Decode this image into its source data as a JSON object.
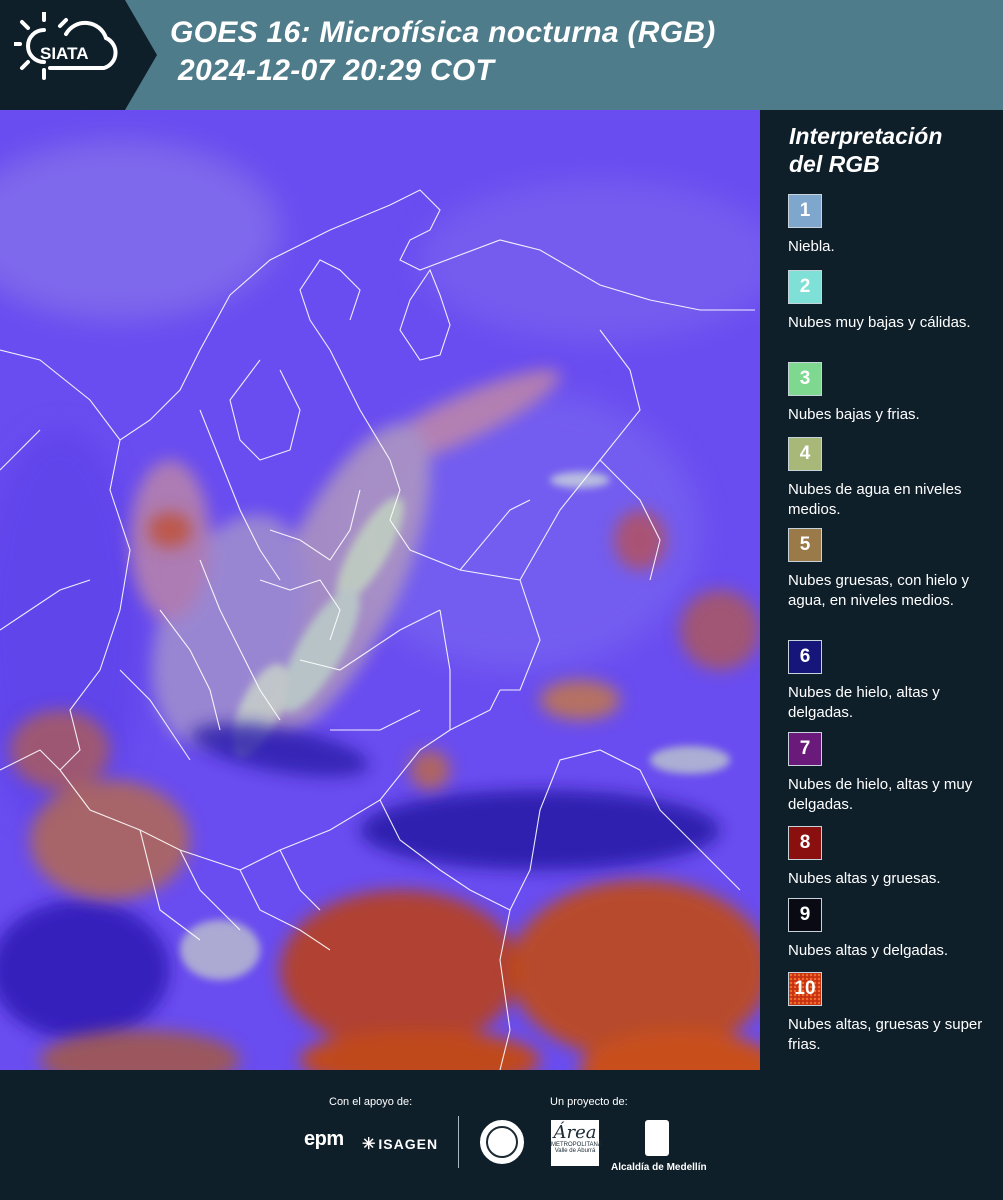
{
  "header": {
    "logo_text": "SIATA",
    "title_line1": "GOES 16: Microfísica nocturna (RGB)",
    "title_line2": "2024-12-07 20:29 COT",
    "bg_color": "#4e7c8a"
  },
  "legend": {
    "title_line1": "Interpretación",
    "title_line2": "del RGB",
    "items": [
      {
        "number": "1",
        "label": "Niebla.",
        "color": "#7fa6cc"
      },
      {
        "number": "2",
        "label": "Nubes muy bajas y cálidas.",
        "color": "#7ee0d6"
      },
      {
        "number": "3",
        "label": "Nubes bajas y frias.",
        "color": "#7fd890"
      },
      {
        "number": "4",
        "label": "Nubes de agua en niveles medios.",
        "color": "#a8b878"
      },
      {
        "number": "5",
        "label": "Nubes gruesas, con hielo y agua, en niveles medios.",
        "color": "#9a7a48"
      },
      {
        "number": "6",
        "label": "Nubes de hielo, altas y delgadas.",
        "color": "#16157a"
      },
      {
        "number": "7",
        "label": "Nubes de hielo, altas y muy delgadas.",
        "color": "#6a1a7a"
      },
      {
        "number": "8",
        "label": "Nubes altas y gruesas.",
        "color": "#8a1010"
      },
      {
        "number": "9",
        "label": "Nubes altas y delgadas.",
        "color": "#0a0a14"
      },
      {
        "number": "10",
        "label": "Nubes altas, gruesas y super frias.",
        "color": "#c83010"
      }
    ]
  },
  "footer": {
    "support_label": "Con el apoyo de:",
    "project_label": "Un proyecto de:",
    "epm": "epm",
    "isagen": "ISAGEN",
    "area_big": "Área",
    "area_small1": "METROPOLITANA",
    "area_small2": "Valle de Aburrá",
    "alcaldia": "Alcaldía de Medellín"
  },
  "map": {
    "background_color": "#6a4df0"
  }
}
